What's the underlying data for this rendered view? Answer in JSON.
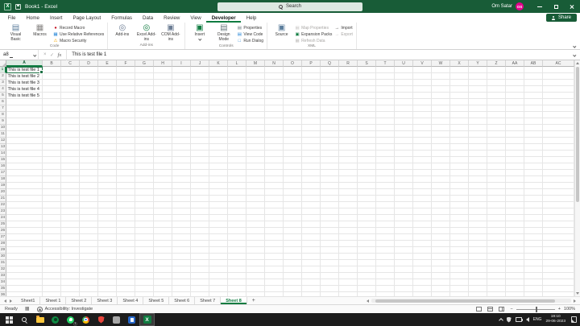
{
  "title_bar": {
    "title": "Book1 - Excel",
    "search_placeholder": "Search",
    "user_name": "Om Satar",
    "avatar_initials": "OS"
  },
  "menu_bar": {
    "tabs": [
      {
        "label": "File"
      },
      {
        "label": "Home"
      },
      {
        "label": "Insert"
      },
      {
        "label": "Page Layout"
      },
      {
        "label": "Formulas"
      },
      {
        "label": "Data"
      },
      {
        "label": "Review"
      },
      {
        "label": "View"
      },
      {
        "label": "Developer",
        "active": true
      },
      {
        "label": "Help"
      }
    ],
    "share_label": "Share"
  },
  "ribbon": {
    "groups": [
      {
        "label": "Code",
        "items": [
          {
            "label": "Visual Basic",
            "type": "large",
            "icon": "visual-basic-icon"
          },
          {
            "label": "Macros",
            "type": "large",
            "icon": "macros-icon"
          },
          {
            "label": "Record Macro",
            "type": "small",
            "icon": "record-macro-icon",
            "stack": 1
          },
          {
            "label": "Use Relative References",
            "type": "small",
            "icon": "relative-references-icon",
            "stack": 1
          },
          {
            "label": "Macro Security",
            "type": "small",
            "icon": "macro-security-icon",
            "stack": 1
          }
        ]
      },
      {
        "label": "Add-ins",
        "items": [
          {
            "label": "Add-ins",
            "type": "large",
            "icon": "add-ins-icon"
          },
          {
            "label": "Excel Add-ins",
            "type": "large",
            "icon": "excel-add-ins-icon"
          },
          {
            "label": "COM Add-ins",
            "type": "large",
            "icon": "com-add-ins-icon"
          }
        ]
      },
      {
        "label": "Controls",
        "items": [
          {
            "label": "Insert",
            "type": "large",
            "icon": "insert-control-icon",
            "dropdown": true
          },
          {
            "label": "Design Mode",
            "type": "large",
            "icon": "design-mode-icon"
          },
          {
            "label": "Properties",
            "type": "small",
            "icon": "properties-icon",
            "stack": 1
          },
          {
            "label": "View Code",
            "type": "small",
            "icon": "view-code-icon",
            "stack": 1
          },
          {
            "label": "Run Dialog",
            "type": "small",
            "icon": "run-dialog-icon",
            "stack": 1
          }
        ]
      },
      {
        "label": "XML",
        "items": [
          {
            "label": "Source",
            "type": "large",
            "icon": "xml-source-icon"
          },
          {
            "label": "Map Properties",
            "type": "small",
            "icon": "map-properties-icon",
            "disabled": true,
            "stack": 1
          },
          {
            "label": "Expansion Packs",
            "type": "small",
            "icon": "expansion-packs-icon",
            "stack": 1
          },
          {
            "label": "Refresh Data",
            "type": "small",
            "icon": "refresh-data-icon",
            "disabled": true,
            "stack": 1
          },
          {
            "label": "Import",
            "type": "small",
            "icon": "import-icon",
            "stack": 2
          },
          {
            "label": "Export",
            "type": "small",
            "icon": "export-icon",
            "disabled": true,
            "stack": 2
          }
        ]
      }
    ]
  },
  "formula_bar": {
    "name_box_value": "a8",
    "cancel_label": "×",
    "enter_label": "✓",
    "fx_label": "fx",
    "formula_value": "This is test file 1"
  },
  "grid": {
    "columns": [
      "A",
      "B",
      "C",
      "D",
      "E",
      "F",
      "G",
      "H",
      "I",
      "J",
      "K",
      "L",
      "M",
      "N",
      "O",
      "P",
      "Q",
      "R",
      "S",
      "T",
      "U",
      "V",
      "W",
      "X",
      "Y",
      "Z",
      "AA",
      "AB",
      "AC"
    ],
    "visible_row_count": 36,
    "selected_cell": "A1",
    "column_a_values": [
      "This is test file 1",
      "This is test file 2",
      "This is test file 3",
      "This is test file 4",
      "This is test file 5"
    ]
  },
  "sheet_bar": {
    "tabs": [
      "Sheet1",
      "Sheet 1",
      "Sheet 2",
      "Sheet 3",
      "Sheet 4",
      "Sheet 5",
      "Sheet 6",
      "Sheet 7",
      "Sheet 8"
    ],
    "active_tab": "Sheet 8",
    "add_sheet_label": "+"
  },
  "status_bar": {
    "mode": "Ready",
    "accessibility_label": "Accessibility: Investigate",
    "zoom_out": "−",
    "zoom_in": "+",
    "zoom_level": "100%"
  },
  "taskbar": {
    "icons": [
      "start-icon",
      "search-icon",
      "file-explorer-icon",
      "green-circle-app-icon",
      "whatsapp-icon",
      "chrome-icon",
      "shield-app-icon",
      "gray-app-icon",
      "blue-app-icon",
      "excel-icon"
    ],
    "active_icon": "excel-icon",
    "whatsapp_badge": "1",
    "tray": {
      "language": "ENG",
      "time": "19:10",
      "date": "29-06-2023"
    }
  },
  "colors": {
    "title_green": "#185C37",
    "accent_green": "#107C41",
    "selection_green": "#1E7145",
    "avatar_pink": "#E3008C"
  }
}
